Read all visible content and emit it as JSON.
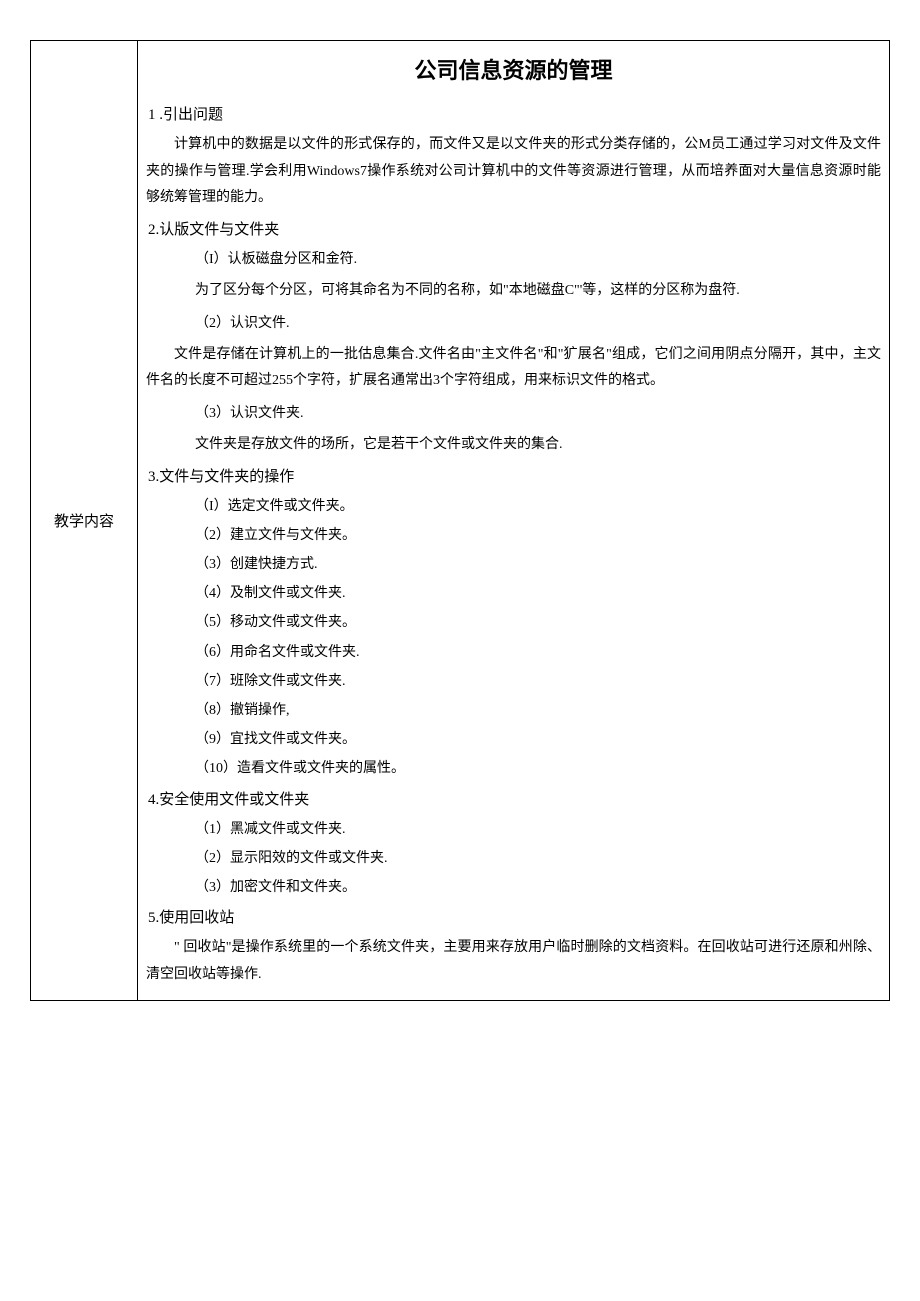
{
  "leftLabel": "教学内容",
  "title": "公司信息资源的管理",
  "sec1": {
    "head": "1          .引出问题",
    "p1": "计算机中的数据是以文件的形式保存的，而文件又是以文件夹的形式分类存储的，公M员工通过学习对文件及文件夹的操作与管理.学会利用Windows7操作系统对公司计算机中的文件等资源进行管理，从而培养面对大量信息资源时能够统筹管理的能力。"
  },
  "sec2": {
    "head": "2.认版文件与文件夹",
    "i1": "（I）认板磁盘分区和金符.",
    "p1": "为了区分每个分区，可将其命名为不同的名称，如\"本地磁盘C\"'等，这样的分区称为盘符.",
    "i2": "（2）认识文件.",
    "p2": "文件是存储在计算机上的一批估息集合.文件名由\"主文件名\"和\"犷展名\"组成，它们之间用阴点分隔开，其中，主文件名的长度不可超过255个字符，扩展名通常出3个字符组成，用来标识文件的格式。",
    "i3": "（3）认识文件夹.",
    "p3": "文件夹是存放文件的场所，它是若干个文件或文件夹的集合."
  },
  "sec3": {
    "head": "3.文件与文件夹的操作",
    "items": [
      "（I）选定文件或文件夹。",
      "（2）建立文件与文件夹。",
      "（3）创建快捷方式.",
      "（4）及制文件或文件夹.",
      "（5）移动文件或文件夹。",
      "（6）用命名文件或文件夹.",
      "（7）班除文件或文件夹.",
      "（8）撤销操作,",
      "（9）宜找文件或文件夹。",
      "（10）造看文件或文件夹的属性。"
    ]
  },
  "sec4": {
    "head": "4.安全使用文件或文件夹",
    "items": [
      "（1）黑减文件或文件夹.",
      "（2）显示阳效的文件或文件夹.",
      "（3）加密文件和文件夹。"
    ]
  },
  "sec5": {
    "head": "5.使用回收站",
    "p1": "\" 回收站\"是操作系统里的一个系统文件夹，主要用来存放用户临时删除的文档资料。在回收站可进行还原和州除、清空回收站等操作."
  }
}
